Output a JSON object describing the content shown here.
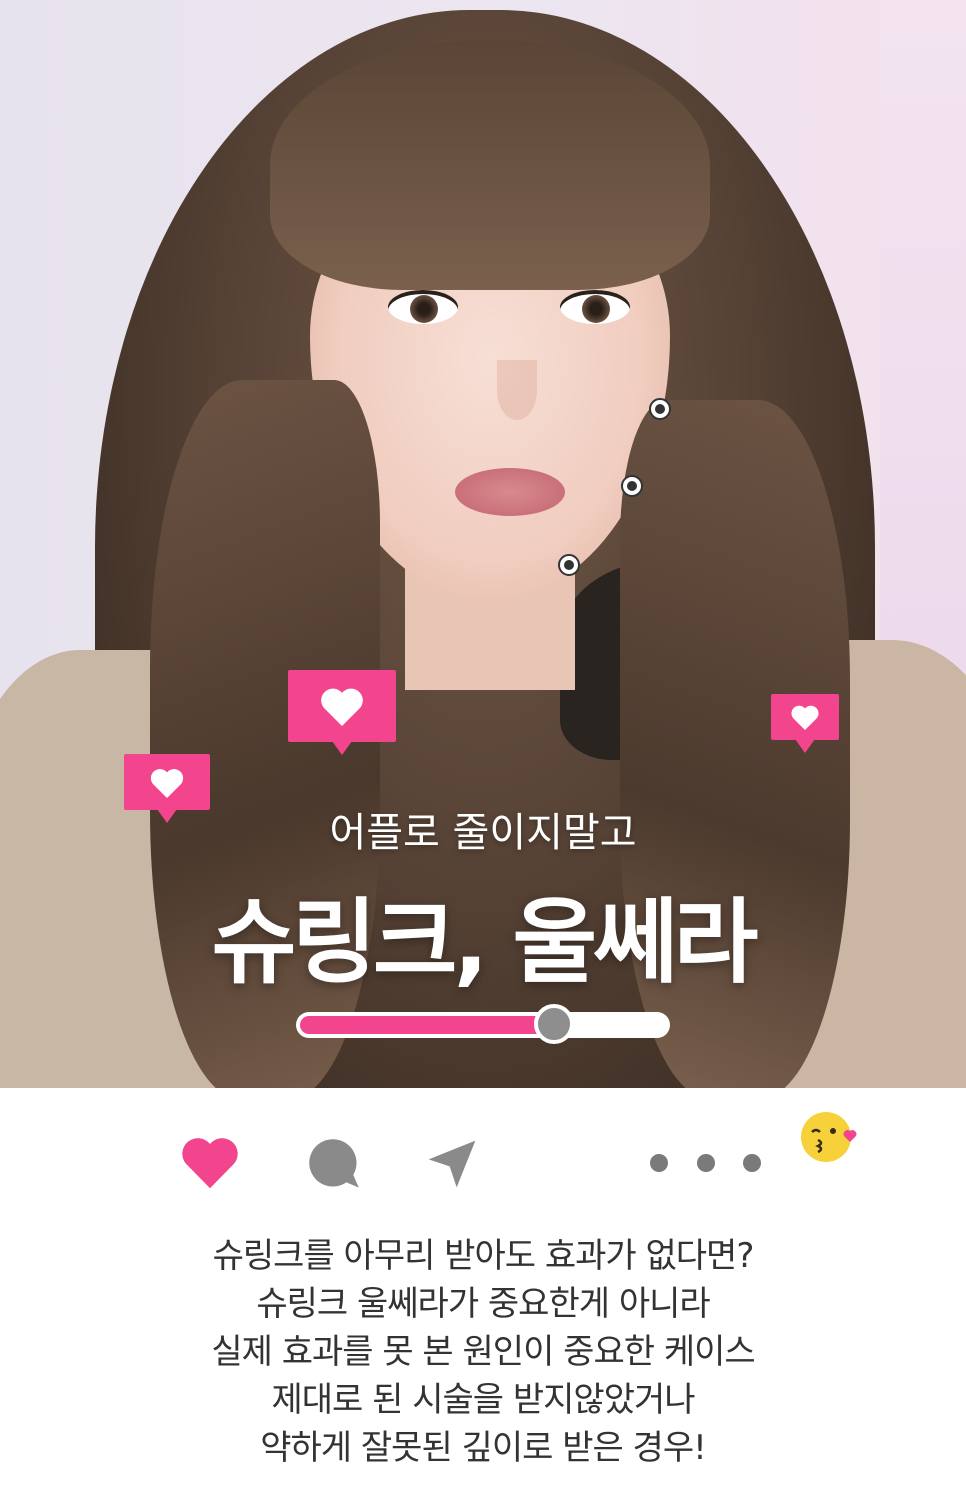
{
  "post": {
    "subtitle": "어플로 줄이지말고",
    "title": "슈링크, 울쎄라",
    "slider_level": 0.69
  },
  "actions": {
    "like_icon": "heart-icon",
    "comment_icon": "comment-icon",
    "share_icon": "send-icon",
    "more_icon": "more-dots-icon",
    "emoji_icon": "kissing-face-emoji"
  },
  "caption": {
    "lines": [
      "슈링크를 아무리 받아도 효과가 없다면?",
      "슈링크 울쎄라가 중요한게 아니라",
      "실제 효과를 못 본 원인이 중요한 케이스",
      "제대로 된 시술을 받지않았거나",
      "약하게 잘못된 깊이로 받은 경우!"
    ]
  },
  "colors": {
    "accent_pink": "#f3448e",
    "icon_gray": "#8a8a8a",
    "text": "#333333"
  }
}
